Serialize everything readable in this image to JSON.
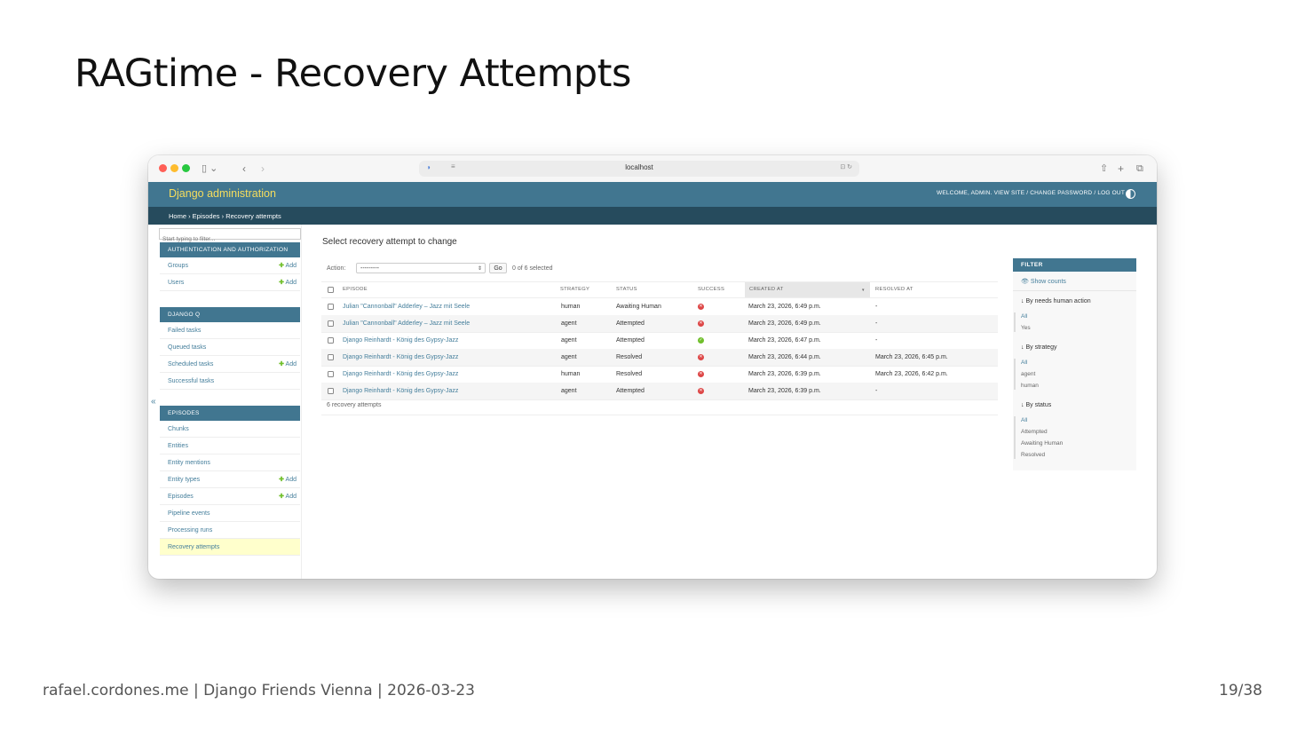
{
  "slide": {
    "title": "RAGtime - Recovery Attempts",
    "footer": "rafael.cordones.me | Django Friends Vienna | 2026-03-23",
    "page": "19/38"
  },
  "browser": {
    "url": "localhost",
    "traffic_lights": [
      "#ff5f57",
      "#febc2e",
      "#28c840"
    ]
  },
  "django": {
    "brand": "Django administration",
    "user_tools": "WELCOME, ADMIN. VIEW SITE / CHANGE PASSWORD / LOG OUT",
    "breadcrumbs": "Home › Episodes › Recovery attempts",
    "colors": {
      "header": "#417690",
      "breadcrumbs": "#264b5d",
      "brand": "#f5dd5d",
      "link": "#447e9b",
      "add": "#70bf2b",
      "error": "#dd4646",
      "success": "#70bf2b",
      "active_row": "#ffffcc"
    }
  },
  "sidebar": {
    "filter_placeholder": "Start typing to filter...",
    "modules": [
      {
        "caption": "AUTHENTICATION AND AUTHORIZATION",
        "items": [
          {
            "label": "Groups",
            "add": "Add"
          },
          {
            "label": "Users",
            "add": "Add"
          }
        ]
      },
      {
        "caption": "DJANGO Q",
        "items": [
          {
            "label": "Failed tasks",
            "add": ""
          },
          {
            "label": "Queued tasks",
            "add": ""
          },
          {
            "label": "Scheduled tasks",
            "add": "Add"
          },
          {
            "label": "Successful tasks",
            "add": ""
          }
        ]
      },
      {
        "caption": "EPISODES",
        "items": [
          {
            "label": "Chunks",
            "add": ""
          },
          {
            "label": "Entities",
            "add": ""
          },
          {
            "label": "Entity mentions",
            "add": ""
          },
          {
            "label": "Entity types",
            "add": "Add"
          },
          {
            "label": "Episodes",
            "add": "Add"
          },
          {
            "label": "Pipeline events",
            "add": ""
          },
          {
            "label": "Processing runs",
            "add": ""
          },
          {
            "label": "Recovery attempts",
            "add": ""
          }
        ]
      }
    ],
    "collapse": "«"
  },
  "main": {
    "title": "Select recovery attempt to change",
    "action_label": "Action:",
    "action_value": "---------",
    "go_label": "Go",
    "selected_count": "0 of 6 selected",
    "columns": [
      "EPISODE",
      "STRATEGY",
      "STATUS",
      "SUCCESS",
      "CREATED AT",
      "RESOLVED AT"
    ],
    "rows": [
      {
        "episode": "Julian \"Cannonball\" Adderley – Jazz mit Seele",
        "strategy": "human",
        "status": "Awaiting Human",
        "success": false,
        "created": "March 23, 2026, 6:49 p.m.",
        "resolved": "-"
      },
      {
        "episode": "Julian \"Cannonball\" Adderley – Jazz mit Seele",
        "strategy": "agent",
        "status": "Attempted",
        "success": false,
        "created": "March 23, 2026, 6:49 p.m.",
        "resolved": "-"
      },
      {
        "episode": "Django Reinhardt - König des Gypsy-Jazz",
        "strategy": "agent",
        "status": "Attempted",
        "success": true,
        "created": "March 23, 2026, 6:47 p.m.",
        "resolved": "-"
      },
      {
        "episode": "Django Reinhardt - König des Gypsy-Jazz",
        "strategy": "agent",
        "status": "Resolved",
        "success": false,
        "created": "March 23, 2026, 6:44 p.m.",
        "resolved": "March 23, 2026, 6:45 p.m."
      },
      {
        "episode": "Django Reinhardt - König des Gypsy-Jazz",
        "strategy": "human",
        "status": "Resolved",
        "success": false,
        "created": "March 23, 2026, 6:39 p.m.",
        "resolved": "March 23, 2026, 6:42 p.m."
      },
      {
        "episode": "Django Reinhardt - König des Gypsy-Jazz",
        "strategy": "agent",
        "status": "Attempted",
        "success": false,
        "created": "March 23, 2026, 6:39 p.m.",
        "resolved": "-"
      }
    ],
    "result_count": "6 recovery attempts"
  },
  "filter": {
    "title": "FILTER",
    "show_counts": "Show counts",
    "groups": [
      {
        "title": "By needs human action",
        "options": [
          "All",
          "Yes"
        ],
        "selected": "All"
      },
      {
        "title": "By strategy",
        "options": [
          "All",
          "agent",
          "human"
        ],
        "selected": "All"
      },
      {
        "title": "By status",
        "options": [
          "All",
          "Attempted",
          "Awaiting Human",
          "Resolved"
        ],
        "selected": "All"
      }
    ]
  }
}
